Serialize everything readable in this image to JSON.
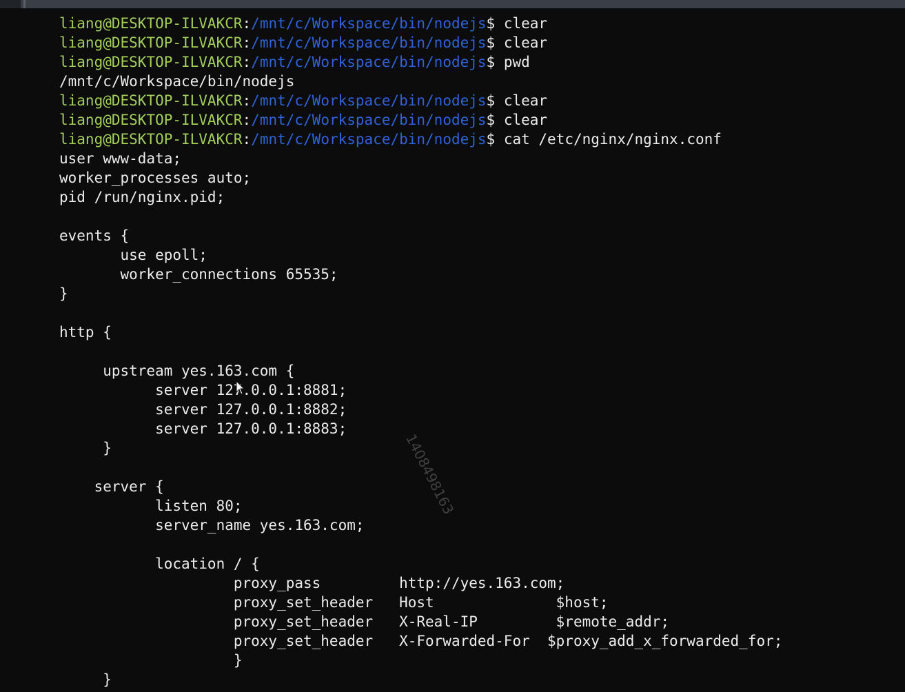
{
  "prompt_lines": [
    {
      "user": "liang@DESKTOP-ILVAKCR",
      "sep": ":",
      "path": "/mnt/c/Workspace/bin/nodejs",
      "dollar": "$ ",
      "command": "clear"
    },
    {
      "user": "liang@DESKTOP-ILVAKCR",
      "sep": ":",
      "path": "/mnt/c/Workspace/bin/nodejs",
      "dollar": "$ ",
      "command": "clear"
    },
    {
      "user": "liang@DESKTOP-ILVAKCR",
      "sep": ":",
      "path": "/mnt/c/Workspace/bin/nodejs",
      "dollar": "$ ",
      "command": "pwd"
    }
  ],
  "pwd_output": "/mnt/c/Workspace/bin/nodejs",
  "prompt_lines_2": [
    {
      "user": "liang@DESKTOP-ILVAKCR",
      "sep": ":",
      "path": "/mnt/c/Workspace/bin/nodejs",
      "dollar": "$ ",
      "command": "clear"
    },
    {
      "user": "liang@DESKTOP-ILVAKCR",
      "sep": ":",
      "path": "/mnt/c/Workspace/bin/nodejs",
      "dollar": "$ ",
      "command": "clear"
    },
    {
      "user": "liang@DESKTOP-ILVAKCR",
      "sep": ":",
      "path": "/mnt/c/Workspace/bin/nodejs",
      "dollar": "$ ",
      "command": "cat /etc/nginx/nginx.conf"
    }
  ],
  "config_lines": [
    "user www-data;",
    "worker_processes auto;",
    "pid /run/nginx.pid;",
    "",
    "events {",
    "       use epoll;",
    "       worker_connections 65535;",
    "}",
    "",
    "http {",
    "",
    "     upstream yes.163.com {",
    "           server 127.0.0.1:8881;",
    "           server 127.0.0.1:8882;",
    "           server 127.0.0.1:8883;",
    "     }",
    "",
    "    server {",
    "           listen 80;",
    "           server_name yes.163.com;",
    "",
    "           location / {",
    "                    proxy_pass         http://yes.163.com;",
    "                    proxy_set_header   Host              $host;",
    "                    proxy_set_header   X-Real-IP         $remote_addr;",
    "                    proxy_set_header   X-Forwarded-For  $proxy_add_x_forwarded_for;",
    "                    }",
    "     }"
  ],
  "watermark": "1408498163",
  "colors": {
    "background": "#0c0c0c",
    "user": "#a3cf5a",
    "path": "#2f62d6",
    "text": "#ececec"
  }
}
